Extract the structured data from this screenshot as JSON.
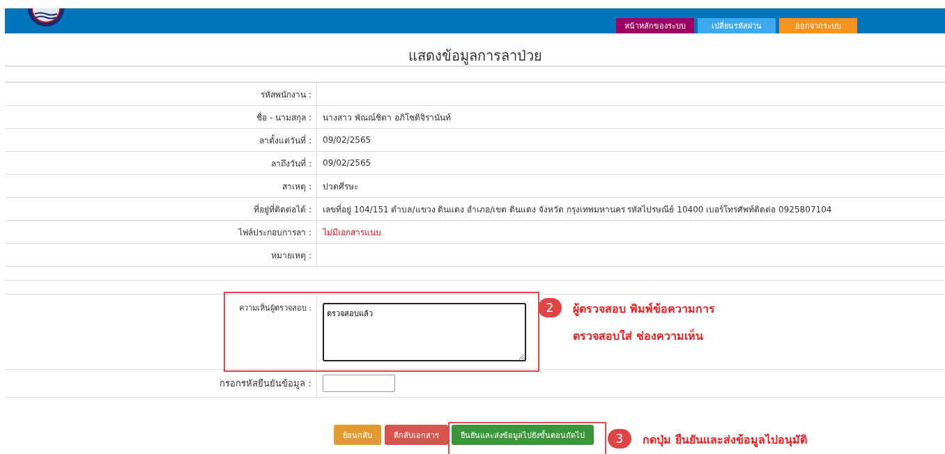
{
  "header": {
    "nav": [
      {
        "label": "หน้าหลักของระบบ",
        "kind": "home"
      },
      {
        "label": "เปลี่ยนรหัสผ่าน",
        "kind": "password"
      },
      {
        "label": "ออกจากระบบ",
        "kind": "logout"
      }
    ]
  },
  "page_title": "แสดงข้อมูลการลาป่วย",
  "details": [
    {
      "label": "รหัสพนักงาน :",
      "kind": "normal"
    },
    {
      "label": "ชื่อ - นามสกุล :",
      "value": "นางสาว พัณณ์ชิตา อภิโชติจิรานันท์",
      "kind": "normal"
    },
    {
      "label": "ลาตั้งแต่วันที่ :",
      "value": "09/02/2565",
      "kind": "normal"
    },
    {
      "label": "ลาถึงวันที่ :",
      "value": "09/02/2565",
      "kind": "normal"
    },
    {
      "label": "สาเหตุ :",
      "value": "ปวดศีรษะ",
      "kind": "normal"
    },
    {
      "label": "ที่อยู่ที่ติดต่อได้ :",
      "value": "เลขที่อยู่ 104/151 ตำบล/แขวง ดินแดง อำเภอ/เขต ดินแดง จังหวัด กรุงเทพมหานคร รหัสไปรษณีย์ 10400 เบอร์โทรศัพท์ติดต่อ 0925807104",
      "kind": "normal"
    },
    {
      "label": "ไฟล์ประกอบการลา :",
      "value": "ไม่มีเอกสารแนบ",
      "kind": "alert"
    },
    {
      "label": "หมายเหตุ :",
      "kind": "normal"
    }
  ],
  "review": {
    "comment_label": "ความเห็นผู้ตรวจสอบ :",
    "comment_value": "ตรวจสอบแล้ว",
    "code_label": "กรอกรหัสยืนยันข้อมูล :"
  },
  "buttons": [
    {
      "label": "ย้อนกลับ",
      "kind": "back"
    },
    {
      "label": "ตีกลับเอกสาร",
      "kind": "reject"
    },
    {
      "label": "ยืนยันและส่งข้อมูลไปยังขั้นตอนถัดไป",
      "kind": "confirm"
    }
  ],
  "annotations": [
    {
      "number": "2",
      "lines": [
        "ผู้ตรวจสอบ พิมพ์ข้อความการ",
        "ตรวจสอบใส่ ช่องความเห็น"
      ]
    },
    {
      "number": "3",
      "lines": [
        "กดปุ่ม ยืนยันและส่งข้อมูลไปอนุมัติ"
      ]
    }
  ]
}
